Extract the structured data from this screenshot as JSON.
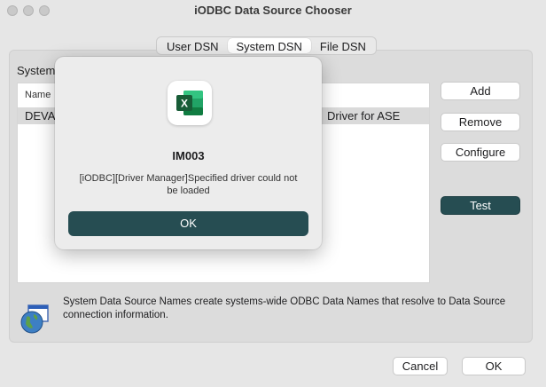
{
  "window": {
    "title": "iODBC Data Source Chooser"
  },
  "tabs": [
    {
      "label": "User DSN",
      "active": false
    },
    {
      "label": "System DSN",
      "active": true
    },
    {
      "label": "File DSN",
      "active": false
    }
  ],
  "panel": {
    "section_label": "System",
    "table": {
      "header_name": "Name",
      "rows": [
        {
          "name": "DEVA",
          "driver": "Driver for ASE"
        }
      ]
    }
  },
  "side_buttons": {
    "add": "Add",
    "remove": "Remove",
    "configure": "Configure",
    "test": "Test"
  },
  "info": {
    "text": "System Data Source Names create systems-wide ODBC Data Names that resolve to Data Source connection information."
  },
  "footer": {
    "cancel": "Cancel",
    "ok": "OK"
  },
  "modal": {
    "app_icon": "excel-icon",
    "title": "IM003",
    "message": "[iODBC][Driver Manager]Specified driver could not be loaded",
    "ok": "OK"
  },
  "colors": {
    "accent_button": "#264d52",
    "excel_green": "#1d6f42"
  }
}
